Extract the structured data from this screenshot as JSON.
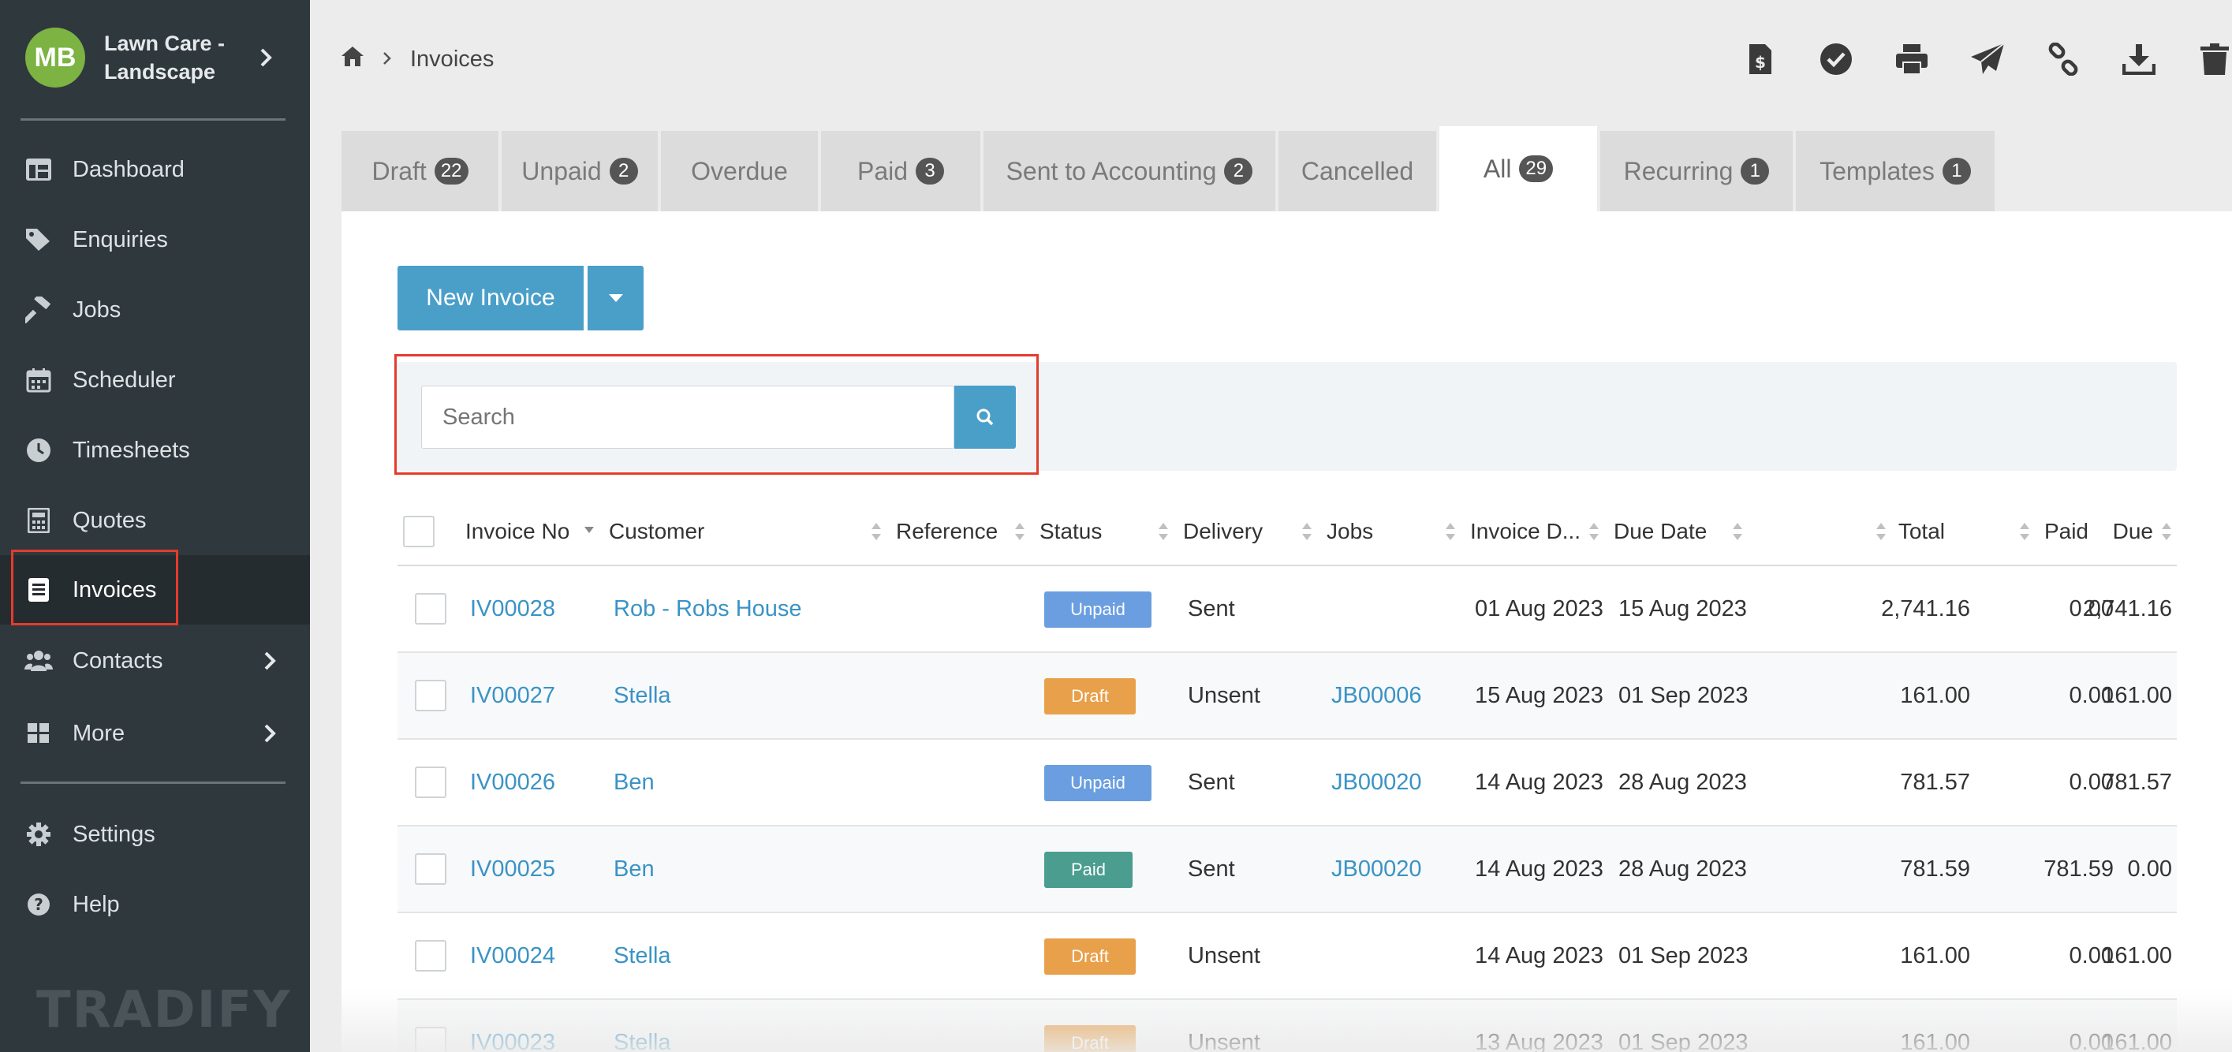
{
  "sidebar": {
    "avatar_initials": "MB",
    "business_name": "Lawn Care - Landscape",
    "items": [
      {
        "label": "Dashboard",
        "icon": "dashboard-icon"
      },
      {
        "label": "Enquiries",
        "icon": "tags-icon"
      },
      {
        "label": "Jobs",
        "icon": "hammer-icon"
      },
      {
        "label": "Scheduler",
        "icon": "calendar-icon"
      },
      {
        "label": "Timesheets",
        "icon": "clock-icon"
      },
      {
        "label": "Quotes",
        "icon": "calculator-icon"
      },
      {
        "label": "Invoices",
        "icon": "invoice-icon",
        "active": true
      },
      {
        "label": "Contacts",
        "icon": "users-icon"
      },
      {
        "label": "More",
        "icon": "grid-icon"
      },
      {
        "label": "Settings",
        "icon": "gear-icon"
      },
      {
        "label": "Help",
        "icon": "question-icon"
      }
    ],
    "watermark": "TRADIFY"
  },
  "breadcrumb": {
    "current": "Invoices"
  },
  "toolbar": [
    "invoice-dollar-icon",
    "check-circle-icon",
    "print-icon",
    "send-icon",
    "link-icon",
    "download-icon",
    "trash-icon"
  ],
  "tabs": [
    {
      "label": "Draft",
      "count": "22"
    },
    {
      "label": "Unpaid",
      "count": "2"
    },
    {
      "label": "Overdue",
      "count": ""
    },
    {
      "label": "Paid",
      "count": "3"
    },
    {
      "label": "Sent to Accounting",
      "count": "2"
    },
    {
      "label": "Cancelled",
      "count": ""
    },
    {
      "label": "All",
      "count": "29",
      "active": true
    },
    {
      "label": "Recurring",
      "count": "1"
    },
    {
      "label": "Templates",
      "count": "1"
    }
  ],
  "actions": {
    "new_invoice": "New Invoice"
  },
  "search": {
    "placeholder": "Search"
  },
  "table": {
    "columns": [
      "Invoice No",
      "Customer",
      "Reference",
      "Status",
      "Delivery",
      "Jobs",
      "Invoice D...",
      "Due Date",
      "Total",
      "Paid",
      "Due"
    ],
    "rows": [
      {
        "invoice": "IV00028",
        "customer": "Rob - Robs House",
        "reference": "",
        "status": "Unpaid",
        "delivery": "Sent",
        "job": "",
        "invoice_date": "01 Aug 2023",
        "due_date": "15 Aug 2023",
        "total": "2,741.16",
        "paid": "0.00",
        "due": "2,741.16"
      },
      {
        "invoice": "IV00027",
        "customer": "Stella",
        "reference": "",
        "status": "Draft",
        "delivery": "Unsent",
        "job": "JB00006",
        "invoice_date": "15 Aug 2023",
        "due_date": "01 Sep 2023",
        "total": "161.00",
        "paid": "0.00",
        "due": "161.00"
      },
      {
        "invoice": "IV00026",
        "customer": "Ben",
        "reference": "",
        "status": "Unpaid",
        "delivery": "Sent",
        "job": "JB00020",
        "invoice_date": "14 Aug 2023",
        "due_date": "28 Aug 2023",
        "total": "781.57",
        "paid": "0.00",
        "due": "781.57"
      },
      {
        "invoice": "IV00025",
        "customer": "Ben",
        "reference": "",
        "status": "Paid",
        "delivery": "Sent",
        "job": "JB00020",
        "invoice_date": "14 Aug 2023",
        "due_date": "28 Aug 2023",
        "total": "781.59",
        "paid": "781.59",
        "due": "0.00"
      },
      {
        "invoice": "IV00024",
        "customer": "Stella",
        "reference": "",
        "status": "Draft",
        "delivery": "Unsent",
        "job": "",
        "invoice_date": "14 Aug 2023",
        "due_date": "01 Sep 2023",
        "total": "161.00",
        "paid": "0.00",
        "due": "161.00"
      },
      {
        "invoice": "IV00023",
        "customer": "Stella",
        "reference": "",
        "status": "Draft",
        "delivery": "Unsent",
        "job": "",
        "invoice_date": "13 Aug 2023",
        "due_date": "01 Sep 2023",
        "total": "161.00",
        "paid": "0.00",
        "due": "161.00"
      }
    ]
  },
  "colors": {
    "sidebar_bg": "#2f383d",
    "accent": "#4a9fc9",
    "highlight": "#e53b2c",
    "status_unpaid": "#6a9ee0",
    "status_draft": "#e8a04a",
    "status_paid": "#4a9d8f"
  }
}
